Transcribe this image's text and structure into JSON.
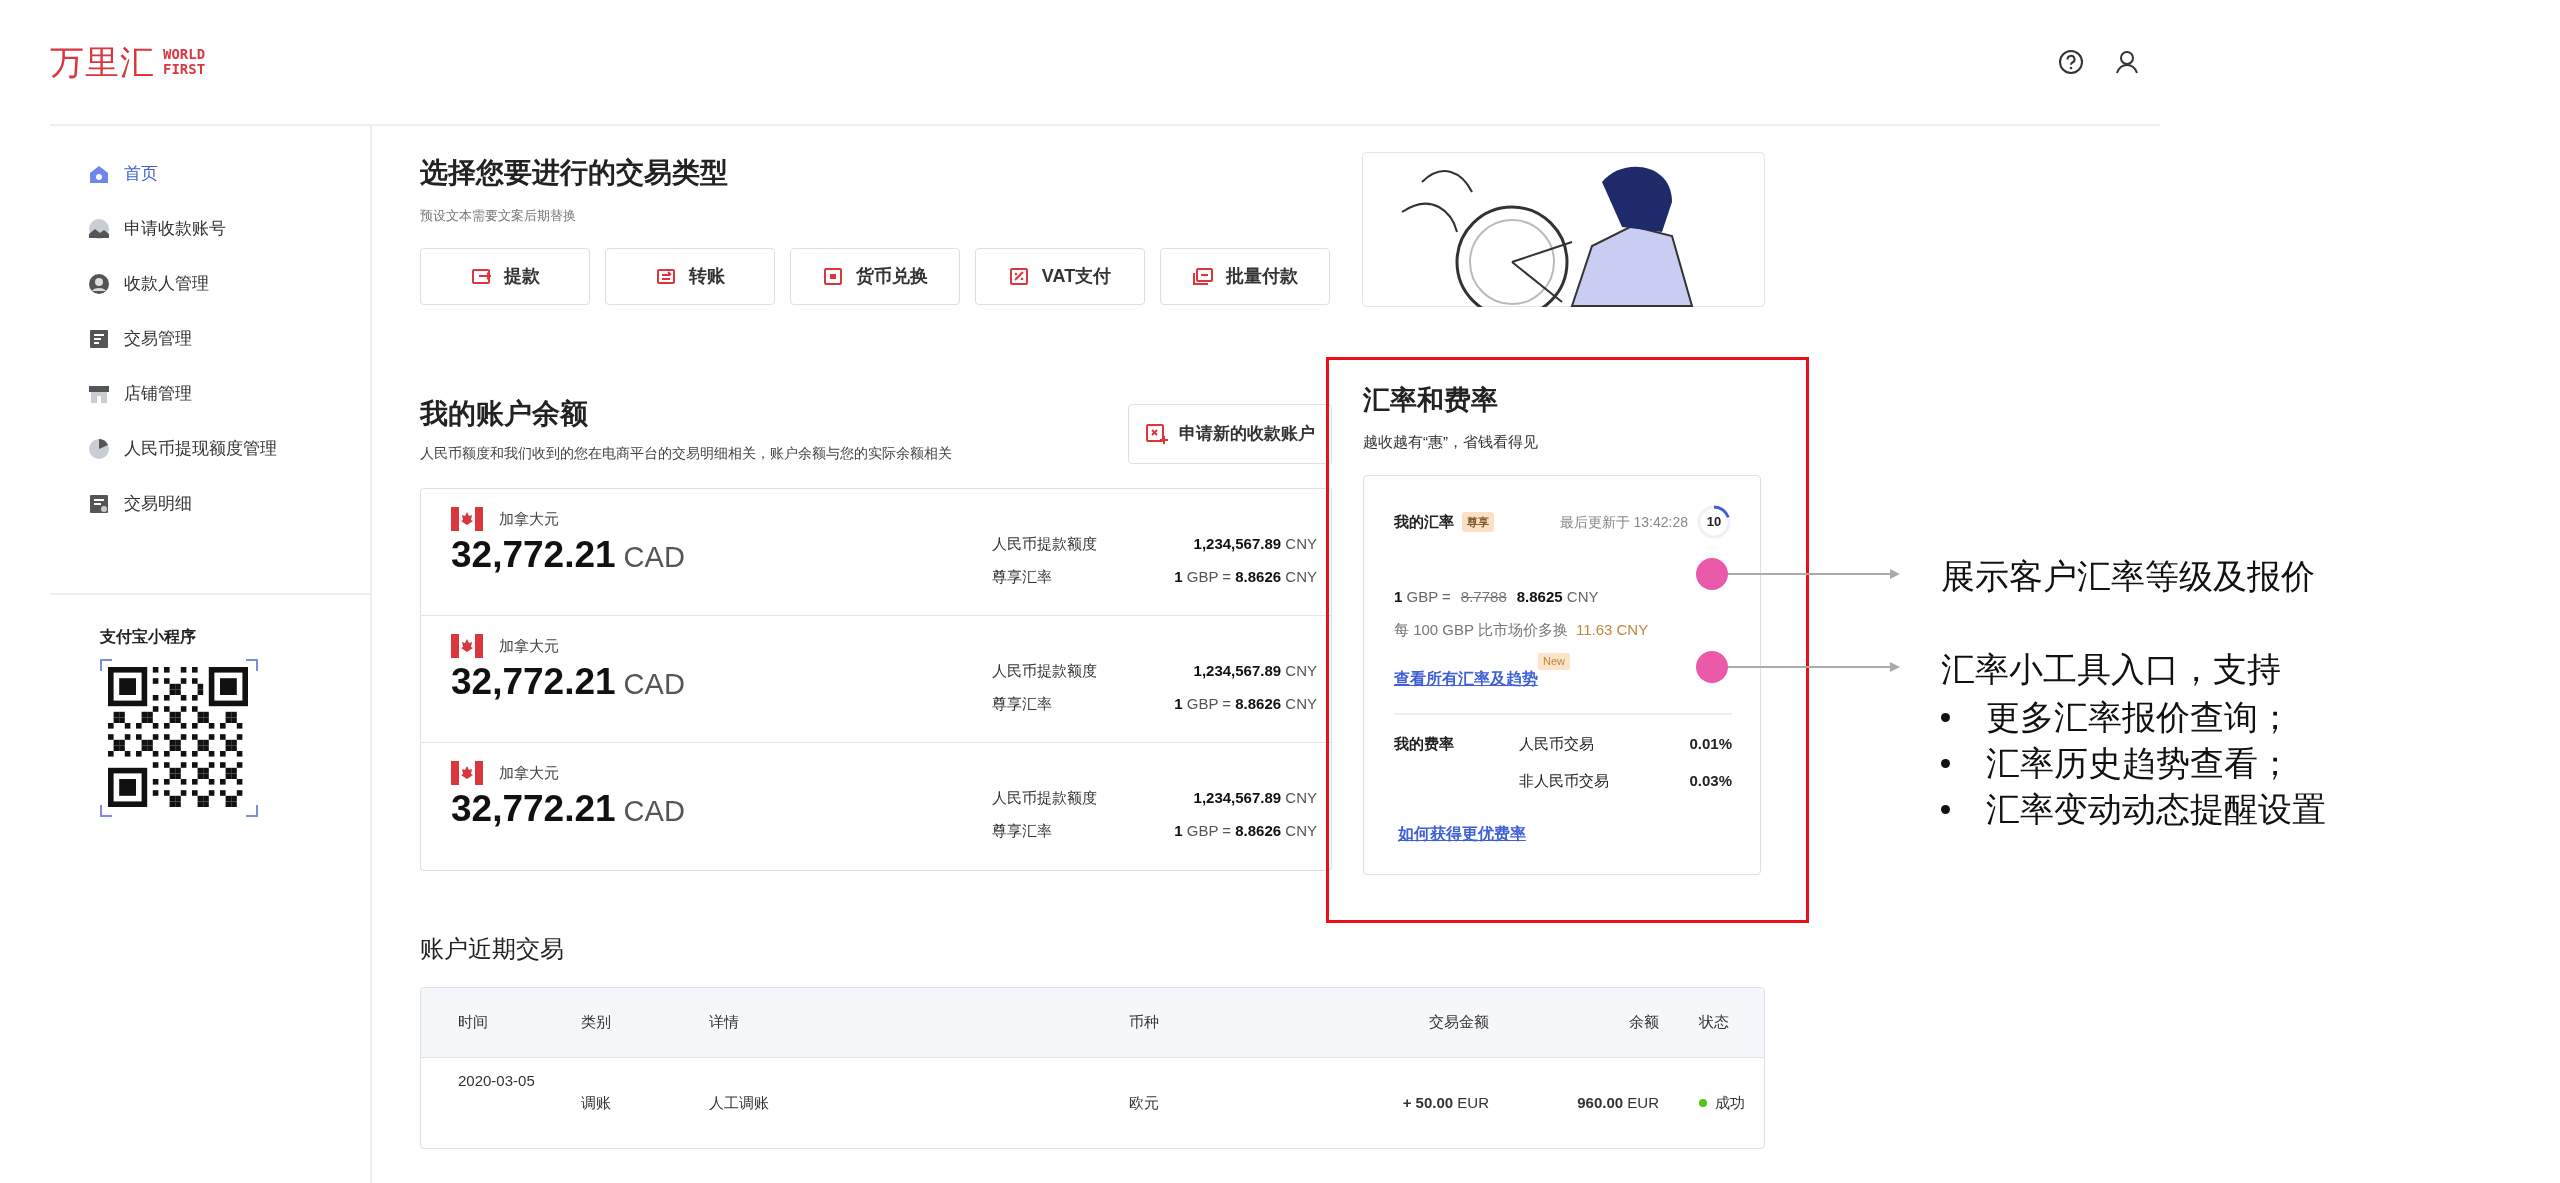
{
  "logo": {
    "name": "万里汇",
    "tag_line_1": "WORLD",
    "tag_line_2": "FIRST"
  },
  "sidebar": {
    "items": [
      {
        "label": "首页",
        "selected": true
      },
      {
        "label": "申请收款账号",
        "selected": false
      },
      {
        "label": "收款人管理",
        "selected": false
      },
      {
        "label": "交易管理",
        "selected": false
      },
      {
        "label": "店铺管理",
        "selected": false
      },
      {
        "label": "人民币提现额度管理",
        "selected": false
      },
      {
        "label": "交易明细",
        "selected": false
      }
    ],
    "mini_program": {
      "title": "支付宝小程序"
    }
  },
  "transaction_types": {
    "title": "选择您要进行的交易类型",
    "subtitle": "预设文本需要文案后期替换",
    "buttons": [
      "提款",
      "转账",
      "货币兑换",
      "VAT支付",
      "批量付款"
    ]
  },
  "balances": {
    "title": "我的账户余额",
    "subtitle": "人民币额度和我们收到的您在电商平台的交易明细相关，账户余额与您的实际余额相关",
    "apply_button": "申请新的收款账户",
    "accounts": [
      {
        "currency_name": "加拿大元",
        "amount": "32,772.21",
        "currency": "CAD",
        "limit_label": "人民币提款额度",
        "limit_value": "**1,234,567.89** CNY",
        "rate_label": "尊享汇率",
        "rate_value": "**1** GBP = **8.8626** CNY"
      },
      {
        "currency_name": "加拿大元",
        "amount": "32,772.21",
        "currency": "CAD",
        "limit_label": "人民币提款额度",
        "limit_value": "**1,234,567.89** CNY",
        "rate_label": "尊享汇率",
        "rate_value": "**1** GBP = **8.8626** CNY"
      },
      {
        "currency_name": "加拿大元",
        "amount": "32,772.21",
        "currency": "CAD",
        "limit_label": "人民币提款额度",
        "limit_value": "**1,234,567.89** CNY",
        "rate_label": "尊享汇率",
        "rate_value": "**1** GBP = **8.8626** CNY"
      }
    ]
  },
  "rates": {
    "title": "汇率和费率",
    "subtitle": "越收越有“惠”，省钱看得见",
    "my_rate_label": "我的汇率",
    "tier_badge": "尊享",
    "updated": "最后更新于 13:42:28",
    "countdown": {
      "value": "10"
    },
    "quote_prefix": "**1** GBP =",
    "old_rate": "8.7788",
    "new_rate": "**8.8625** CNY",
    "savings_text": "每 100 GBP 比市场价多换",
    "savings_amount": "11.63 CNY",
    "all_rates_link": "查看所有汇率及趋势",
    "new_badge": "New",
    "fees_label": "我的费率",
    "fees": [
      {
        "label": "人民币交易",
        "value": "0.01%"
      },
      {
        "label": "非人民币交易",
        "value": "0.03%"
      }
    ],
    "better_rate_link": "如何获得更优费率"
  },
  "annotations": [
    {
      "title": "展示客户汇率等级及报价"
    },
    {
      "title": "汇率小工具入口，支持",
      "bullets": [
        "更多汇率报价查询；",
        "汇率历史趋势查看；",
        "汇率变动动态提醒设置"
      ]
    }
  ],
  "recent_transactions": {
    "title": "账户近期交易",
    "columns": [
      "时间",
      "类别",
      "详情",
      "币种",
      "交易金额",
      "余额",
      "状态"
    ],
    "rows": [
      {
        "time": "2020-03-05",
        "type": "调账",
        "details": "人工调账",
        "currency": "欧元",
        "amount": "**+ 50.00** EUR",
        "balance": "**960.00** EUR",
        "status": "成功",
        "color": "#52c41a"
      }
    ]
  }
}
